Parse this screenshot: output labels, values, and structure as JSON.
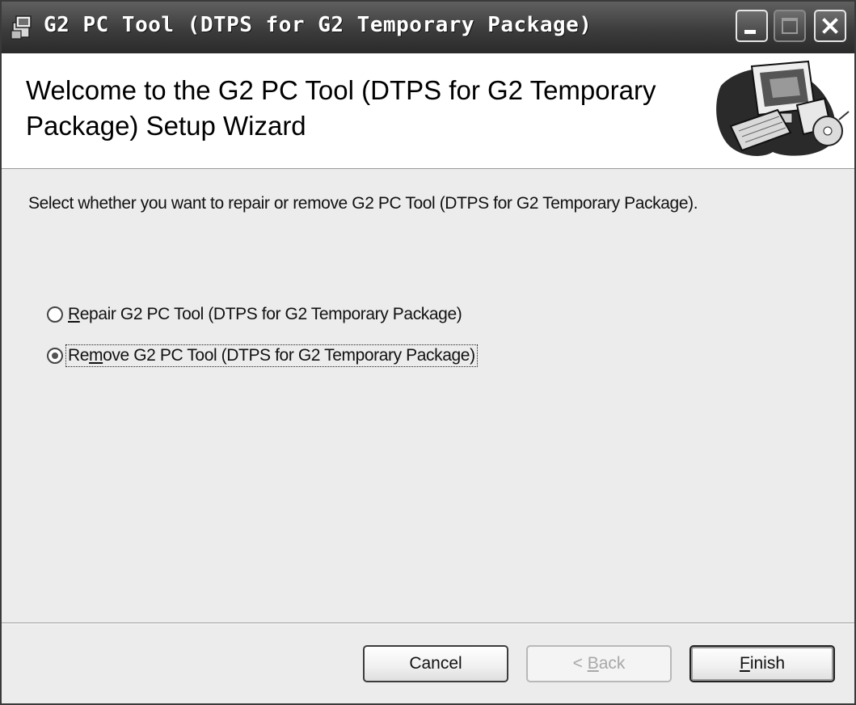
{
  "window": {
    "title": "G2 PC Tool (DTPS for G2 Temporary Package)",
    "controls": {
      "minimize_icon": "minimize-icon",
      "maximize_icon": "maximize-icon",
      "close_icon": "close-icon"
    }
  },
  "banner": {
    "title": "Welcome to the G2 PC Tool (DTPS for G2 Temporary Package) Setup Wizard",
    "graphic_icon": "computer-setup-graphic"
  },
  "body": {
    "instruction": "Select whether you want to repair or remove G2 PC Tool (DTPS for G2 Temporary Package).",
    "options": [
      {
        "accel": "R",
        "rest": "epair G2 PC Tool (DTPS for G2 Temporary Package)",
        "selected": false
      },
      {
        "pre": "Re",
        "accel": "m",
        "rest": "ove G2 PC Tool (DTPS for G2 Temporary Package)",
        "selected": true
      }
    ]
  },
  "buttons": {
    "cancel": "Cancel",
    "back_prefix": "< ",
    "back_accel": "B",
    "back_rest": "ack",
    "back_enabled": false,
    "finish_accel": "F",
    "finish_rest": "inish"
  }
}
